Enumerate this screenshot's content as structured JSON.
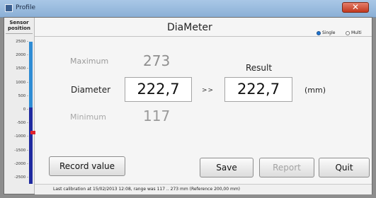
{
  "window": {
    "title": "Profile",
    "close_label": "✕"
  },
  "sensor": {
    "title_line1": "Sensor",
    "title_line2": "position",
    "ticks": [
      "2500",
      "2000",
      "1500",
      "1000",
      "500",
      "0",
      "-500",
      "-1000",
      "-1500",
      "-2000",
      "-2500"
    ]
  },
  "header": {
    "app_title": "DiaMeter",
    "mode_single": "Single",
    "mode_multi": "Multi",
    "selected_mode": "Single"
  },
  "measurement": {
    "maximum_label": "Maximum",
    "maximum_value": "273",
    "result_label": "Result",
    "diameter_label": "Diameter",
    "diameter_value": "222,7",
    "arrow": ">>",
    "result_value": "222,7",
    "unit": "(mm)",
    "minimum_label": "Minimum",
    "minimum_value": "117"
  },
  "buttons": {
    "record": "Record value",
    "save": "Save",
    "report": "Report",
    "quit": "Quit"
  },
  "status": {
    "text": "Last calibration at 15/02/2013 12:08, range was 117 .. 273 mm (Reference 200,00 mm)"
  },
  "colors": {
    "gauge_upper": "#2f8cd4",
    "gauge_lower": "#1f2aa0",
    "gauge_marker": "#e0202b"
  }
}
